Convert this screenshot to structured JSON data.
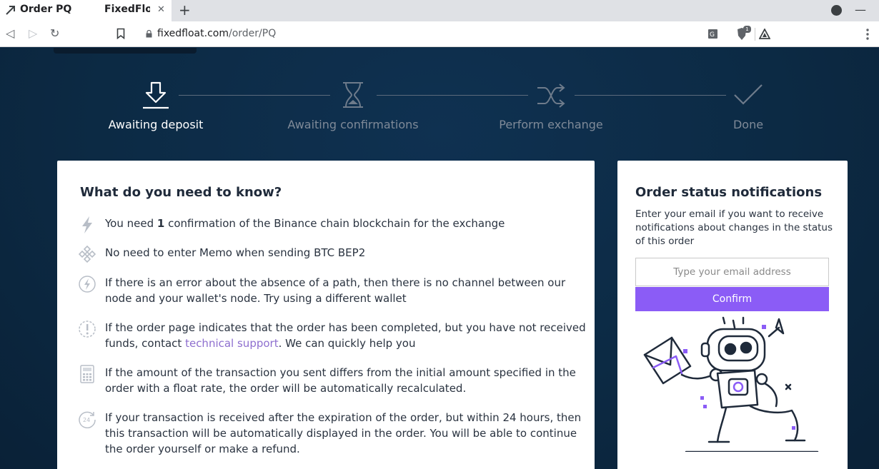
{
  "browser": {
    "tab_title_1": "Order PQ",
    "tab_title_2": "FixedFloat",
    "close_glyph": "✕",
    "new_tab_glyph": "+",
    "url_host": "fixedfloat.com",
    "url_path": "/order/PQ",
    "back_glyph": "◁",
    "forward_glyph": "▷",
    "reload_glyph": "↻",
    "minimize_glyph": "—",
    "brave_badge": "1"
  },
  "steps": [
    {
      "label": "Awaiting deposit",
      "icon": "download-arrow-icon",
      "state": "active"
    },
    {
      "label": "Awaiting confirmations",
      "icon": "hourglass-icon",
      "state": "inactive"
    },
    {
      "label": "Perform exchange",
      "icon": "shuffle-icon",
      "state": "inactive"
    },
    {
      "label": "Done",
      "icon": "checkmark-icon",
      "state": "inactive"
    }
  ],
  "know": {
    "title": "What do you need to know?",
    "items": [
      {
        "icon": "lightning-icon",
        "before": "You need ",
        "bold": "1",
        "after": " confirmation of the Binance chain blockchain for the exchange"
      },
      {
        "icon": "binance-diamond-icon",
        "text": "No need to enter Memo when sending BTC BEP2"
      },
      {
        "icon": "lightning-circle-icon",
        "text": "If there is an error about the absence of a path, then there is no channel between our node and your wallet's node. Try using a different wallet"
      },
      {
        "icon": "exclamation-circle-icon",
        "before": "If the order page indicates that the order has been completed, but you have not received funds, contact ",
        "link": "technical support",
        "after": ". We can quickly help you"
      },
      {
        "icon": "calculator-icon",
        "text": "If the amount of the transaction you sent differs from the initial amount specified in the order with a float rate, the order will be automatically recalculated."
      },
      {
        "icon": "clock-24-icon",
        "text": "If your transaction is received after the expiration of the order, but within 24 hours, then this transaction will be automatically displayed in the order. You will be able to continue the order yourself or make a refund."
      }
    ]
  },
  "notifications": {
    "title": "Order status notifications",
    "description": "Enter your email if you want to receive notifications about changes in the status of this order",
    "email_placeholder": "Type your email address",
    "email_value": "",
    "confirm_label": "Confirm"
  },
  "colors": {
    "accent": "#8b5cf6",
    "background": "#0d2a45",
    "link": "#8e6fcf"
  }
}
